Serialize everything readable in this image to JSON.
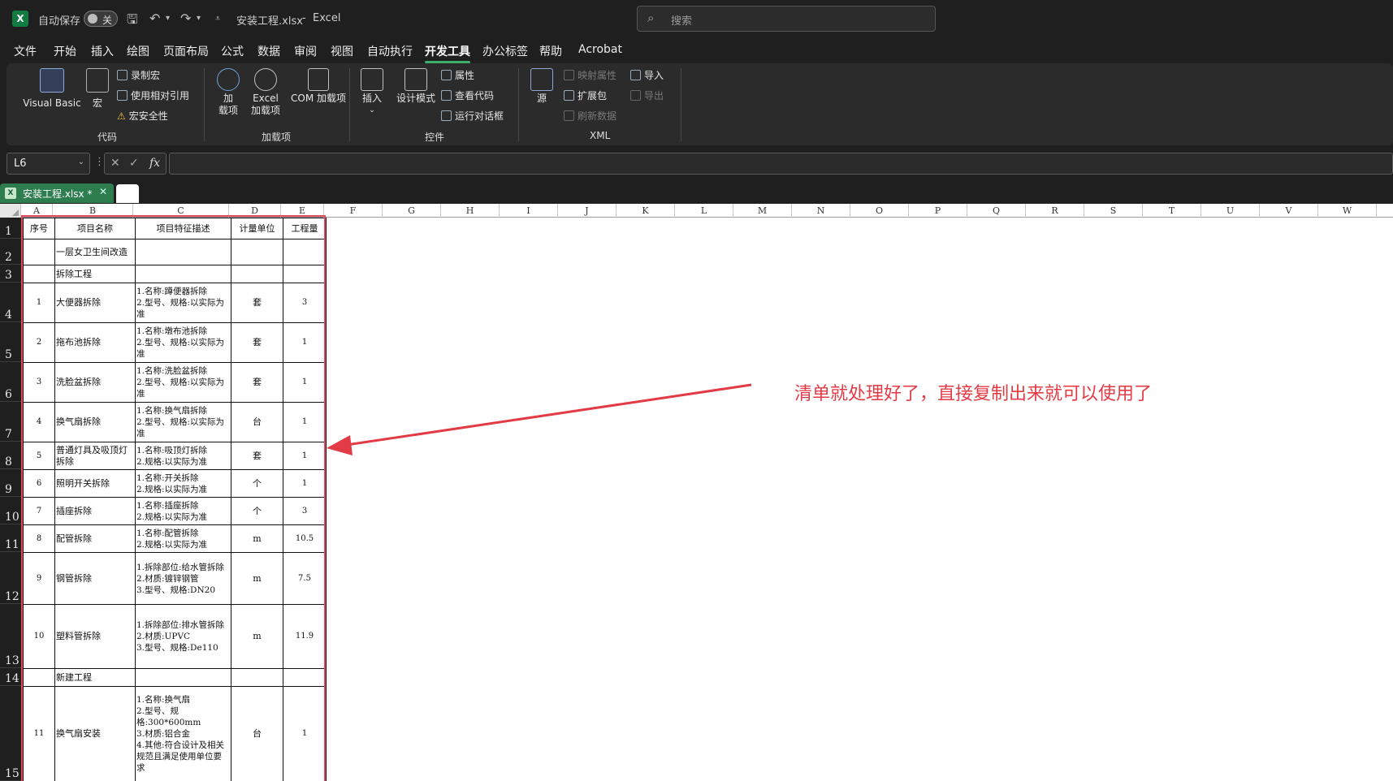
{
  "titlebar": {
    "autosave_label": "自动保存",
    "autosave_state": "关",
    "file_title": "安装工程.xlsx",
    "separator": "-",
    "app_name": "Excel",
    "search_placeholder": "搜索"
  },
  "menu": [
    "文件",
    "开始",
    "插入",
    "绘图",
    "页面布局",
    "公式",
    "数据",
    "审阅",
    "视图",
    "自动执行",
    "开发工具",
    "办公标签",
    "帮助",
    "Acrobat"
  ],
  "menu_active": "开发工具",
  "ribbon": {
    "groups": {
      "code": "代码",
      "addins": "加载项",
      "controls": "控件",
      "xml": "XML"
    },
    "code": {
      "visual_basic": "Visual Basic",
      "macro": "宏",
      "record_macro": "录制宏",
      "relative_ref": "使用相对引用",
      "macro_security": "宏安全性"
    },
    "addins": {
      "add_line1": "加",
      "add_line2": "载项",
      "excel_line1": "Excel",
      "excel_line2": "加载项",
      "com": "COM 加载项"
    },
    "controls": {
      "insert": "插入",
      "design_mode": "设计模式",
      "properties": "属性",
      "view_code": "查看代码",
      "run_dialog": "运行对话框"
    },
    "xml": {
      "source": "源",
      "map_props": "映射属性",
      "expansion": "扩展包",
      "refresh": "刷新数据",
      "import": "导入",
      "export": "导出"
    }
  },
  "formula_bar": {
    "name_box": "L6",
    "fx": "fx",
    "value": ""
  },
  "tab": {
    "file": "安装工程.xlsx *"
  },
  "columns": [
    "A",
    "B",
    "C",
    "D",
    "E",
    "F",
    "G",
    "H",
    "I",
    "J",
    "K",
    "L",
    "M",
    "N",
    "O",
    "P",
    "Q",
    "R",
    "S",
    "T",
    "U",
    "V",
    "W"
  ],
  "rows": [
    {
      "num": "1",
      "a": "序号",
      "b": "项目名称",
      "c": "项目特征描述",
      "d": "计量单位",
      "e": "工程量"
    },
    {
      "num": "2",
      "a": "",
      "b": "一层女卫生间改造",
      "c": "",
      "d": "",
      "e": ""
    },
    {
      "num": "3",
      "a": "",
      "b": "拆除工程",
      "c": "",
      "d": "",
      "e": ""
    },
    {
      "num": "4",
      "a": "1",
      "b": "大便器拆除",
      "c": "1.名称:蹲便器拆除\n2.型号、规格:以实际为准",
      "d": "套",
      "e": "3"
    },
    {
      "num": "5",
      "a": "2",
      "b": "拖布池拆除",
      "c": "1.名称:墩布池拆除\n2.型号、规格:以实际为准",
      "d": "套",
      "e": "1"
    },
    {
      "num": "6",
      "a": "3",
      "b": "洗脸盆拆除",
      "c": "1.名称:洗脸盆拆除\n2.型号、规格:以实际为准",
      "d": "套",
      "e": "1"
    },
    {
      "num": "7",
      "a": "4",
      "b": "换气扇拆除",
      "c": "1.名称:换气扇拆除\n2.型号、规格:以实际为准",
      "d": "台",
      "e": "1"
    },
    {
      "num": "8",
      "a": "5",
      "b": "普通灯具及吸顶灯拆除",
      "c": "1.名称:吸顶灯拆除\n2.规格:以实际为准",
      "d": "套",
      "e": "1"
    },
    {
      "num": "9",
      "a": "6",
      "b": "照明开关拆除",
      "c": "1.名称:开关拆除\n2.规格:以实际为准",
      "d": "个",
      "e": "1"
    },
    {
      "num": "10",
      "a": "7",
      "b": "插座拆除",
      "c": "1.名称:插座拆除\n2.规格:以实际为准",
      "d": "个",
      "e": "3"
    },
    {
      "num": "11",
      "a": "8",
      "b": "配管拆除",
      "c": "1.名称:配管拆除\n2.规格:以实际为准",
      "d": "m",
      "e": "10.5"
    },
    {
      "num": "12",
      "a": "9",
      "b": "钢管拆除",
      "c": "1.拆除部位:给水管拆除\n2.材质:镀锌钢管\n3.型号、规格:DN20",
      "d": "m",
      "e": "7.5"
    },
    {
      "num": "13",
      "a": "10",
      "b": "塑料管拆除",
      "c": "1.拆除部位:排水管拆除\n2.材质:UPVC\n3.型号、规格:De110",
      "d": "m",
      "e": "11.9"
    },
    {
      "num": "14",
      "a": "",
      "b": "新建工程",
      "c": "",
      "d": "",
      "e": ""
    },
    {
      "num": "15",
      "a": "11",
      "b": "换气扇安装",
      "c": "1.名称:换气扇\n2.型号、规格:300*600mm\n3.材质:铝合金\n4.其他:符合设计及相关规范且满足使用单位要求",
      "d": "台",
      "e": "1"
    }
  ],
  "annotation": "清单就处理好了，直接复制出来就可以使用了",
  "colors": {
    "accent": "#3fae6a",
    "annotation": "#e33b46",
    "excel_green": "#107c41"
  }
}
